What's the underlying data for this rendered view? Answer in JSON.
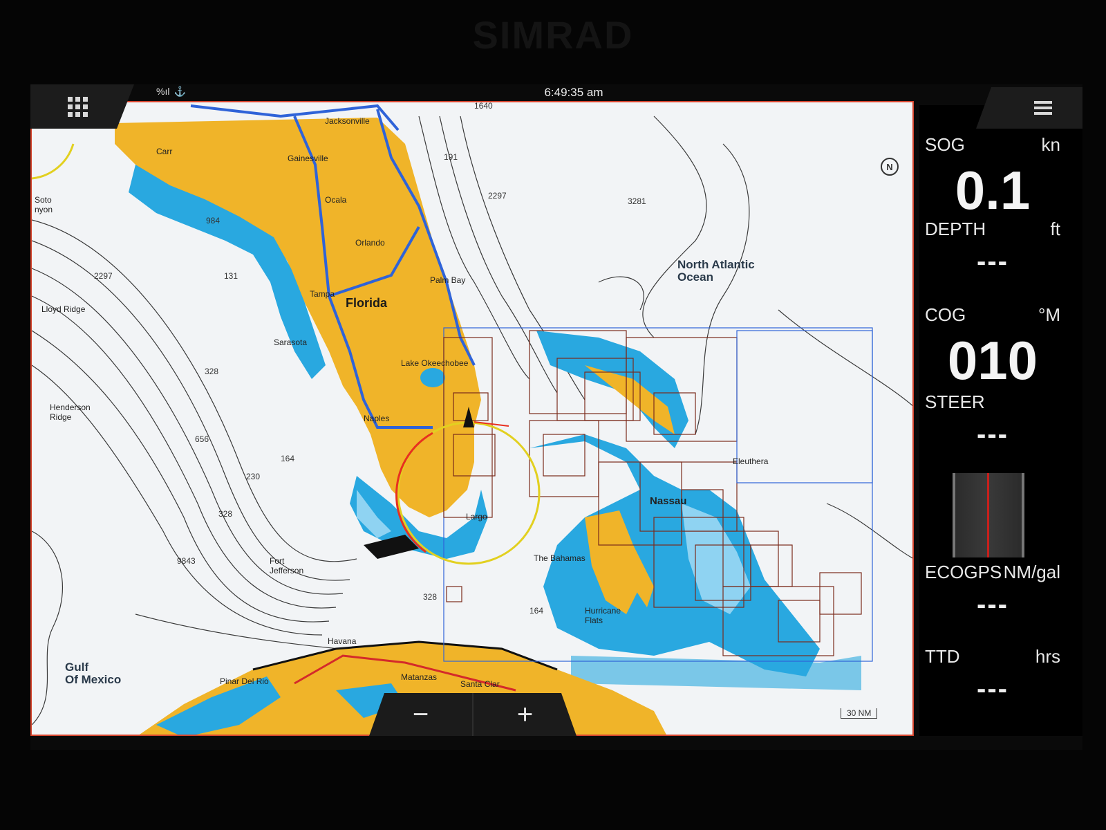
{
  "bezel": {
    "brand": "SIMRAD"
  },
  "topbar": {
    "time": "6:49:35 am",
    "signal_icon": "signal-bars-icon",
    "alarm_icon": "anchor-alarm-icon",
    "apps_icon": "apps-grid-icon",
    "menu_icon": "hamburger-menu-icon"
  },
  "map": {
    "labels": {
      "jacksonville": "Jacksonville",
      "gainesville": "Gainesville",
      "ocala": "Ocala",
      "orlando": "Orlando",
      "florida": "Florida",
      "palm_bay": "Palm Bay",
      "lake_okeechobee": "Lake Okeechobee",
      "naples": "Naples",
      "sarasota": "Sarasota",
      "tampa": "Tampa",
      "largo": "Largo",
      "lloyd_ridge": "Lloyd Ridge",
      "henderson_ridge": "Henderson Ridge",
      "soto_canyon": "Soto\nnyon",
      "gulf_of_mexico": "Gulf\nOf Mexico",
      "north_atlantic_ocean": "North Atlantic\nOcean",
      "nassau": "Nassau",
      "eleuthera": "Eleuthera",
      "the_bahamas": "The Bahamas",
      "fort_jefferson": "Fort\nJefferson",
      "pinar_del_rio": "Pinar Del Rio",
      "havana": "Havana",
      "matanzas": "Matanzas",
      "santa_clara": "Santa Clar",
      "hurricane_flats": "Hurricane\nFlats",
      "carrabelle": "Carr"
    },
    "depths": [
      "1640",
      "191",
      "2297",
      "3281",
      "984",
      "131",
      "2297",
      "328",
      "656",
      "164",
      "230",
      "328",
      "9843",
      "328",
      "164"
    ],
    "scale": "30 NM",
    "colors": {
      "land": "#f0b429",
      "shallow": "#29a8e0",
      "deep_shallow": "#8fd3f2",
      "sea": "#f2f4f6",
      "route": "#2f63d8",
      "frame": "#d6452e"
    }
  },
  "zoom": {
    "minus": "−",
    "plus": "+"
  },
  "panel": {
    "sog": {
      "label": "SOG",
      "unit": "kn",
      "value": "0.1"
    },
    "depth": {
      "label": "DEPTH",
      "unit": "ft",
      "value": "---"
    },
    "cog": {
      "label": "COG",
      "unit": "°M",
      "value": "010"
    },
    "steer": {
      "label": "STEER",
      "value": "---"
    },
    "ecogps": {
      "label": "ECOGPS",
      "unit": "NM/gal",
      "value": "---"
    },
    "ttd": {
      "label": "TTD",
      "unit": "hrs",
      "value": "---"
    }
  }
}
